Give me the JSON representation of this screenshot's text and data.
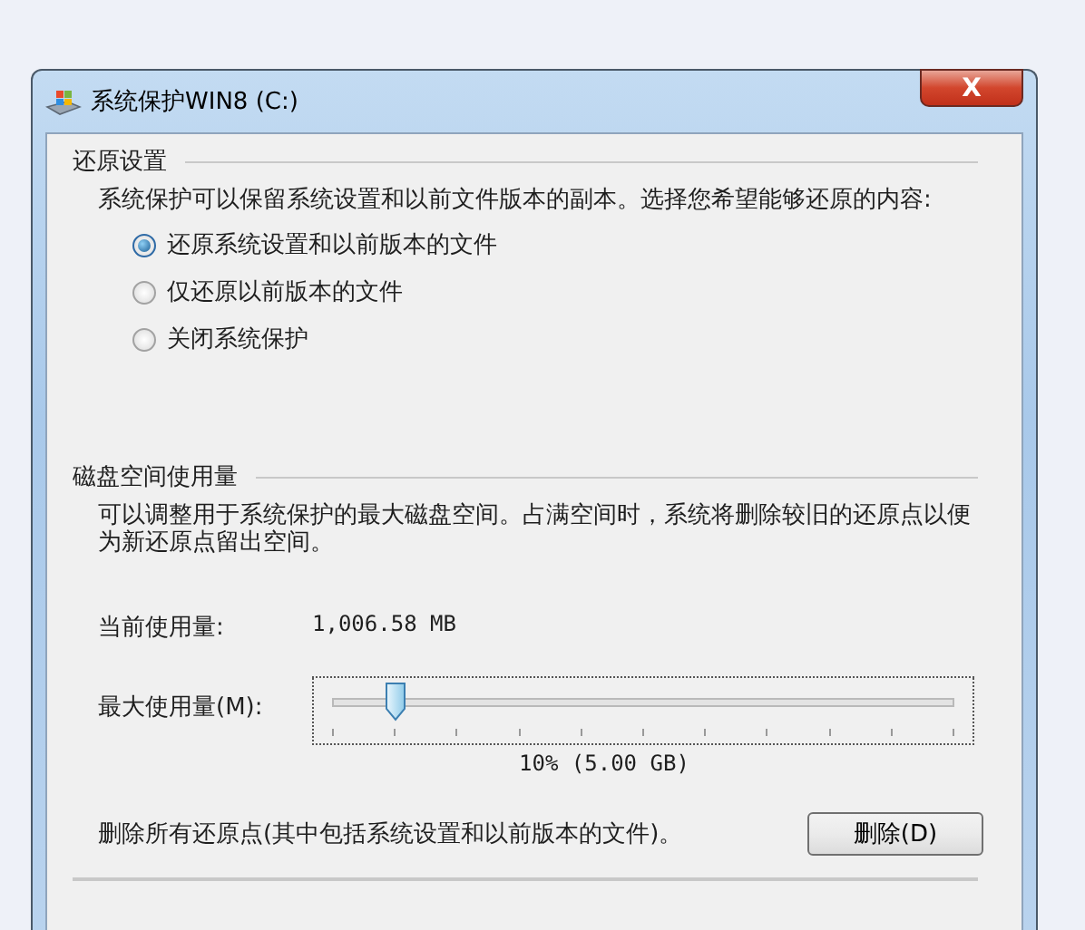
{
  "window": {
    "title": "系统保护WIN8 (C:)",
    "close": "X"
  },
  "restore_settings": {
    "heading": "还原设置",
    "description": "系统保护可以保留系统设置和以前文件版本的副本。选择您希望能够还原的内容:",
    "options": [
      {
        "label": "还原系统设置和以前版本的文件",
        "selected": true
      },
      {
        "label": "仅还原以前版本的文件",
        "selected": false
      },
      {
        "label": "关闭系统保护",
        "selected": false
      }
    ]
  },
  "disk_usage": {
    "heading": "磁盘空间使用量",
    "description": "可以调整用于系统保护的最大磁盘空间。占满空间时，系统将删除较旧的还原点以便为新还原点留出空间。",
    "current_label": "当前使用量:",
    "current_value": "1,006.58 MB",
    "max_label": "最大使用量(M):",
    "slider": {
      "level": 0.1
    },
    "slider_reading": "10% (5.00 GB)",
    "delete_text": "删除所有还原点(其中包括系统设置和以前版本的文件)。",
    "delete_button": "删除(D)"
  }
}
